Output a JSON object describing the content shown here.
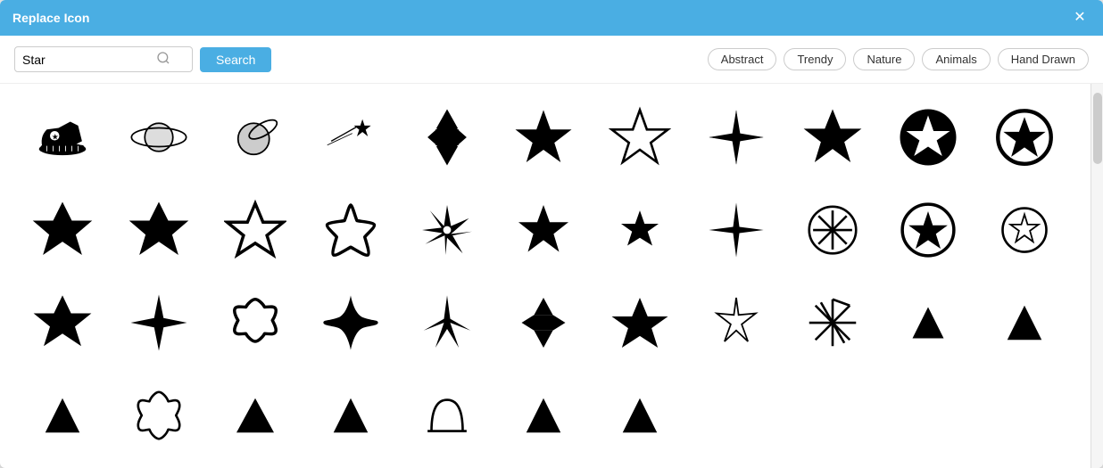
{
  "dialog": {
    "title": "Replace Icon",
    "close_label": "✕"
  },
  "search": {
    "value": "Star",
    "placeholder": "Star",
    "button_label": "Search",
    "icon": "🔍"
  },
  "categories": [
    {
      "id": "abstract",
      "label": "Abstract"
    },
    {
      "id": "trendy",
      "label": "Trendy"
    },
    {
      "id": "nature",
      "label": "Nature"
    },
    {
      "id": "animals",
      "label": "Animals"
    },
    {
      "id": "hand-drawn",
      "label": "Hand Drawn"
    }
  ],
  "icons": [
    "shoe-star",
    "planet",
    "death-star",
    "shooting-star",
    "star-of-david",
    "filled-star",
    "outlined-star",
    "nautical-star",
    "large-star",
    "star-in-circle",
    "bold-star-1",
    "bold-star-2",
    "outlined-star-2",
    "rounded-star",
    "ninja-star",
    "medium-star",
    "small-star",
    "decorative-star",
    "cross-star",
    "star-badge",
    "small-outlined-star",
    "medium-bold-star",
    "pointed-star",
    "flower-star",
    "curved-star",
    "triangle-star",
    "hexagram",
    "fat-star",
    "delicate-star",
    "burst-star",
    "mountain-1",
    "mountain-2",
    "mountain-3",
    "leaf-star",
    "mountain-4",
    "mountain-5",
    "dome",
    "mountain-6",
    "mountain-7"
  ]
}
